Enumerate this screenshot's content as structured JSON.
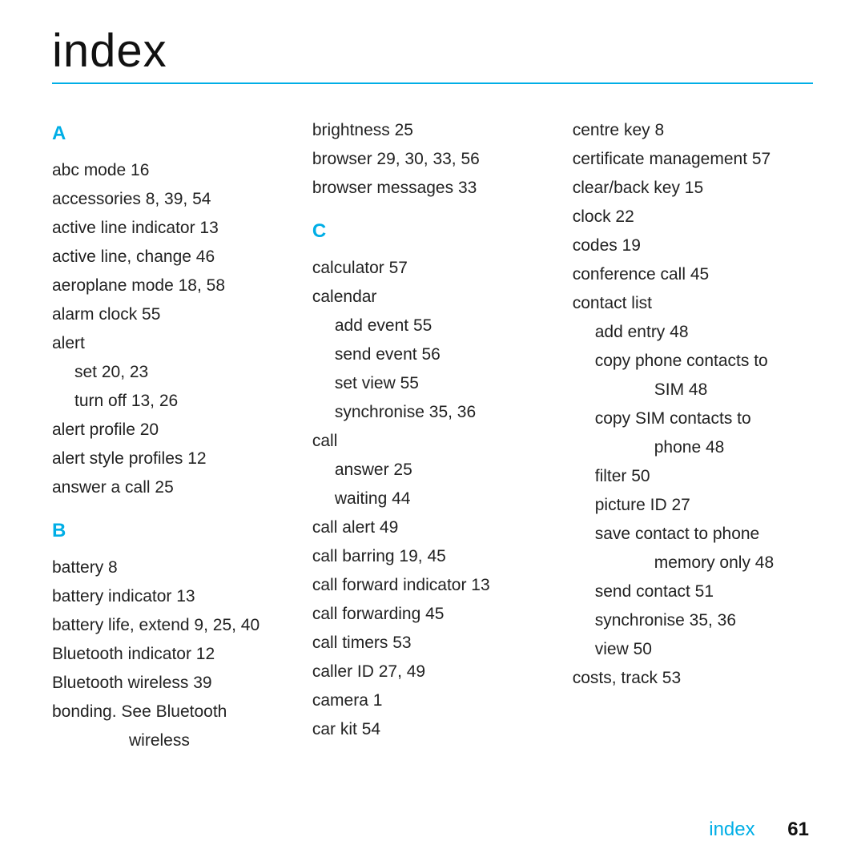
{
  "title": "index",
  "col1": {
    "letterA": "A",
    "a0": "abc mode  16",
    "a1": "accessories  8, 39, 54",
    "a2": "active line indicator  13",
    "a3": "active line, change  46",
    "a4": "aeroplane mode  18, 58",
    "a5": "alarm clock  55",
    "a6": "alert",
    "a6a": "set  20, 23",
    "a6b": "turn off  13, 26",
    "a7": "alert profile  20",
    "a8": "alert style profiles  12",
    "a9": "answer a call  25",
    "letterB": "B",
    "b0": "battery  8",
    "b1": "battery indicator  13",
    "b2": "battery life, extend  9, 25, 40",
    "b3": "Bluetooth indicator  12",
    "b4": "Bluetooth wireless  39",
    "b5": "bonding. See Bluetooth",
    "b5a": "wireless"
  },
  "col2": {
    "t0": "brightness  25",
    "t1": "browser  29, 30, 33, 56",
    "t2": "browser messages  33",
    "letterC": "C",
    "c0": "calculator  57",
    "c1": "calendar",
    "c1a": "add event  55",
    "c1b": "send event  56",
    "c1c": "set view  55",
    "c1d": "synchronise  35, 36",
    "c2": "call",
    "c2a": "answer  25",
    "c2b": "waiting  44",
    "c3": "call alert  49",
    "c4": "call barring  19, 45",
    "c5": "call forward indicator  13",
    "c6": "call forwarding  45",
    "c7": "call timers  53",
    "c8": "caller ID  27, 49",
    "c9": "camera  1",
    "c10": "car kit  54"
  },
  "col3": {
    "d0": "centre key  8",
    "d1": "certificate management  57",
    "d2": "clear/back key  15",
    "d3": "clock  22",
    "d4": "codes  19",
    "d5": "conference call  45",
    "d6": "contact list",
    "d6a": "add entry  48",
    "d6b": "copy phone contacts to",
    "d6b2": "SIM  48",
    "d6c": "copy SIM contacts to",
    "d6c2": "phone  48",
    "d6d": "filter  50",
    "d6e": "picture ID  27",
    "d6f": "save contact to phone",
    "d6f2": "memory only  48",
    "d6g": "send contact  51",
    "d6h": "synchronise  35, 36",
    "d6i": "view  50",
    "d7": "costs, track  53"
  },
  "footer": {
    "label": "index",
    "page": "61"
  }
}
